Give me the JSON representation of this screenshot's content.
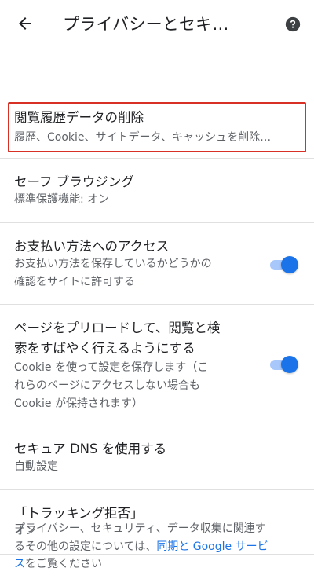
{
  "toolbar": {
    "title": "プライバシーとセキ…",
    "back_icon": "arrow-left-icon",
    "help_icon": "help-circle-icon"
  },
  "items": [
    {
      "label": "閲覧履歴データの削除",
      "sub": "履歴、Cookie、サイトデータ、キャッシュを削除…",
      "highlighted": true
    },
    {
      "label": "セーフ ブラウジング",
      "sub": "標準保護機能: オン"
    },
    {
      "label": "お支払い方法へのアクセス",
      "sub_lines": [
        "お支払い方法を保存しているかどうかの",
        "確認をサイトに許可する"
      ],
      "toggle_on": true
    },
    {
      "label_lines": [
        "ページをプリロードして、閲覧と検",
        "索をすばやく行えるようにする"
      ],
      "sub_lines": [
        "Cookie を使って設定を保存します（こ",
        "れらのページにアクセスしない場合も",
        "Cookie が保持されます）"
      ],
      "toggle_on": true
    },
    {
      "label": "セキュア DNS を使用する",
      "sub": "自動設定"
    },
    {
      "label": "「トラッキング拒否」",
      "sub": "オン"
    }
  ],
  "footer": {
    "line1": "プライバシー、セキュリティ、データ収集に関連す",
    "line2_prefix": "るその他の設定については、",
    "link_part1": "同期と Google サービ",
    "link_part2": "ス",
    "line3_suffix": "をご覧ください"
  },
  "colors": {
    "accent": "#1a73e8",
    "highlight_border": "#d93025"
  }
}
